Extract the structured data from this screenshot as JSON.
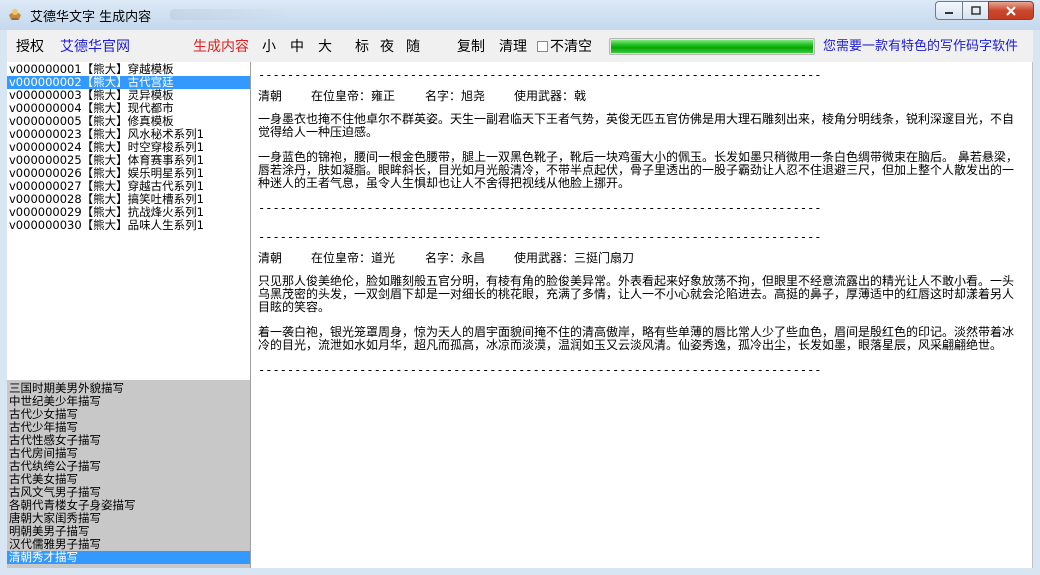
{
  "window": {
    "title": "艾德华文字 生成内容",
    "icon": "app-icon"
  },
  "toolbar": {
    "auth": "授权",
    "website": "艾德华官网",
    "generate": "生成内容",
    "small": "小",
    "medium": "中",
    "large": "大",
    "standard": "标",
    "night": "夜",
    "random": "随",
    "copy": "复制",
    "clear": "清理",
    "no_clear": "不清空",
    "no_clear_checked": false,
    "progress": 1.0,
    "tagline": "您需要一款有特色的写作码字软件"
  },
  "templates": [
    "v000000001【熊大】穿越模板",
    "v000000002【熊大】古代宫廷",
    "v000000003【熊大】灵异模板",
    "v000000004【熊大】现代都市",
    "v000000005【熊大】修真模板",
    "v000000023【熊大】风水秘术系列1",
    "v000000024【熊大】时空穿梭系列1",
    "v000000025【熊大】体育赛事系列1",
    "v000000026【熊大】娱乐明星系列1",
    "v000000027【熊大】穿越古代系列1",
    "v000000028【熊大】搞笑吐槽系列1",
    "v000000029【熊大】抗战烽火系列1",
    "v000000030【熊大】品味人生系列1"
  ],
  "templates_selected": 1,
  "descriptions": [
    "三国时期美男外貌描写",
    "中世纪美少年描写",
    "古代少女描写",
    "古代少年描写",
    "古代性感女子描写",
    "古代房间描写",
    "古代纨绔公子描写",
    "古代美女描写",
    "古风文气男子描写",
    "各朝代青楼女子身姿描写",
    "唐朝大家闺秀描写",
    "明朝美男子描写",
    "汉代儒雅男子描写",
    "清朝秀才描写"
  ],
  "descriptions_selected": 13,
  "articles": [
    {
      "separator": "------------------------------------------------------------------------------------------------",
      "dynasty": "清朝",
      "emperor": "在位皇帝：雍正",
      "name": "名字：旭尧",
      "weapon": "使用武器：戟",
      "paragraphs": [
        "一身墨衣也掩不住他卓尔不群英姿。天生一副君临天下王者气势，英俊无匹五官仿佛是用大理石雕刻出来，棱角分明线条，锐利深邃目光，不自觉得给人一种压迫感。",
        "一身蓝色的锦袍，腰间一根金色腰带，腿上一双黑色靴子，靴后一块鸡蛋大小的佩玉。长发如墨只稍微用一条白色绸带微束在脑后。 鼻若悬梁，唇若涂丹，肤如凝脂。眼眸斜长，目光如月光般清冷，不带半点起伏，骨子里透出的一股子霸劲让人忍不住退避三尺，但加上整个人散发出的一种迷人的王者气息，虽令人生惧却也让人不舍得把视线从他脸上挪开。"
      ]
    },
    {
      "separator": "------------------------------------------------------------------------------------------------",
      "dynasty": "清朝",
      "emperor": "在位皇帝：道光",
      "name": "名字：永昌",
      "weapon": "使用武器：三挺门扇刀",
      "paragraphs": [
        "只见那人俊美绝伦，脸如雕刻般五官分明，有棱有角的脸俊美异常。外表看起来好象放荡不拘，但眼里不经意流露出的精光让人不敢小看。一头乌黑茂密的头发，一双剑眉下却是一对细长的桃花眼，充满了多情，让人一不小心就会沦陷进去。高挺的鼻子，厚薄适中的红唇这时却漾着另人目眩的笑容。",
        "着一袭白袍，银光笼罩周身，惊为天人的眉宇面貌间掩不住的清高傲岸，略有些单薄的唇比常人少了些血色，眉间是殷红色的印记。淡然带着冰冷的目光，流泄如水如月华，超凡而孤高，冰凉而淡漠，温润如玉又云淡风清。仙姿秀逸，孤冷出尘，长发如墨，眼落星辰，风采翩翩绝世。"
      ]
    }
  ]
}
